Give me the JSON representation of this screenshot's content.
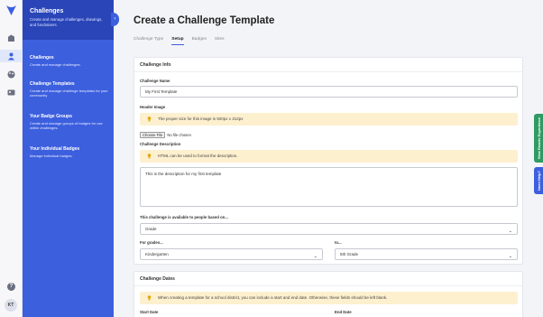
{
  "rail": {
    "icons": [
      "logo-icon",
      "building-icon",
      "person-icon",
      "palette-icon",
      "image-icon"
    ],
    "help_label": "?",
    "avatar_initials": "KT"
  },
  "nav": {
    "title": "Challenges",
    "subtitle": "Create and manage challenges, drawings, and fundraisers.",
    "items": [
      {
        "title": "Challenges",
        "desc": "Create and manage challenges."
      },
      {
        "title": "Challenge Templates",
        "desc": "Create and manage challenge templates for your community"
      },
      {
        "title": "Your Badge Groups",
        "desc": "Create and manage groups of badges for use within challenges."
      },
      {
        "title": "Your Individual Badges",
        "desc": "Manage individual badges."
      }
    ]
  },
  "page": {
    "title": "Create a Challenge Template",
    "tabs": [
      "Challenge Type",
      "Setup",
      "Badges",
      "Sites"
    ],
    "active_tab": "Setup"
  },
  "info": {
    "heading": "Challenge Info",
    "name_label": "Challenge Name",
    "name_value": "My First Template",
    "header_label": "Header Image",
    "header_note": "The proper size for this image is 920px x 312px",
    "file_button": "Choose File",
    "file_status": "No file chosen",
    "desc_label": "Challenge Description",
    "desc_note": "HTML can be used to format the description.",
    "desc_value": "This is the description for my first template",
    "based_label": "This challenge is available to people based on...",
    "based_value": "Grade",
    "grades_label": "For grades...",
    "grades_from": "Kindergarten",
    "to_label": "to...",
    "grades_to": "5th Grade"
  },
  "dates": {
    "heading": "Challenge Dates",
    "note": "When creating a template for a school district, you can include a start and end date. Otherwise, these fields should be left blank.",
    "start_label": "Start Date",
    "end_label": "End Date"
  },
  "side_tabs": {
    "experience": "View Reader Experience",
    "help": "Need Help?"
  },
  "colors": {
    "nav_blue": "#3c5fde",
    "nav_header": "#2945b8",
    "note_yellow": "#fdf0cf",
    "experience_green": "#2f9a63",
    "help_blue": "#3c5fde"
  }
}
